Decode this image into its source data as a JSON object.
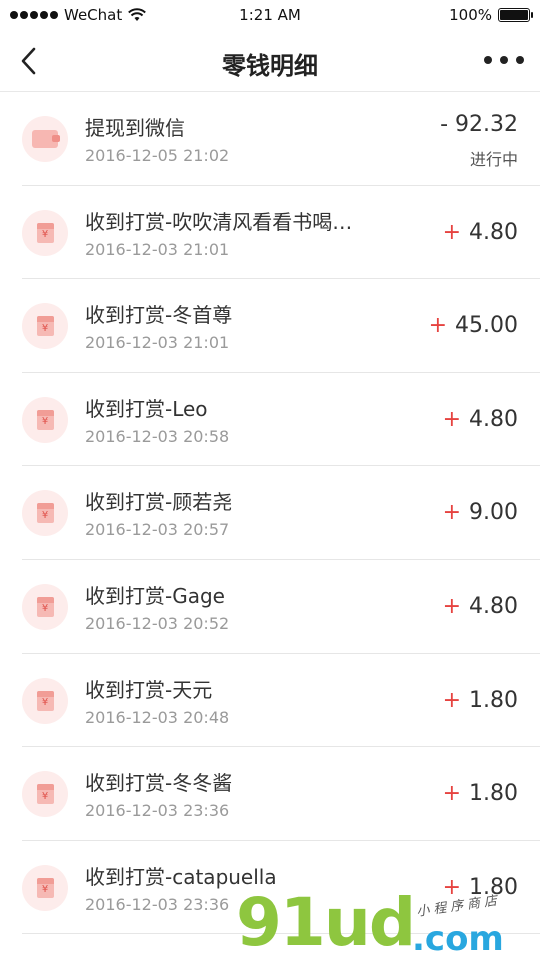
{
  "status_bar": {
    "carrier": "WeChat",
    "time": "1:21 AM",
    "battery": "100%"
  },
  "nav": {
    "title": "零钱明细"
  },
  "transactions": [
    {
      "title": "提现到微信",
      "time": "2016-12-05 21:02",
      "sign": "-",
      "amount": "- 92.32",
      "status": "进行中",
      "icon": "wallet-icon"
    },
    {
      "title": "收到打赏-吹吹清风看看书喝…",
      "time": "2016-12-03 21:01",
      "sign": "+",
      "amount": "4.80",
      "icon": "red-envelope-icon"
    },
    {
      "title": "收到打赏-冬首尊",
      "time": "2016-12-03 21:01",
      "sign": "+",
      "amount": "45.00",
      "icon": "red-envelope-icon"
    },
    {
      "title": "收到打赏-Leo",
      "time": "2016-12-03 20:58",
      "sign": "+",
      "amount": "4.80",
      "icon": "red-envelope-icon"
    },
    {
      "title": "收到打赏-顾若尧",
      "time": "2016-12-03 20:57",
      "sign": "+",
      "amount": "9.00",
      "icon": "red-envelope-icon"
    },
    {
      "title": "收到打赏-Gage",
      "time": "2016-12-03 20:52",
      "sign": "+",
      "amount": "4.80",
      "icon": "red-envelope-icon"
    },
    {
      "title": "收到打赏-天元",
      "time": "2016-12-03 20:48",
      "sign": "+",
      "amount": "1.80",
      "icon": "red-envelope-icon"
    },
    {
      "title": "收到打赏-冬冬酱",
      "time": "2016-12-03 23:36",
      "sign": "+",
      "amount": "1.80",
      "icon": "red-envelope-icon"
    },
    {
      "title": "收到打赏-catapuella",
      "time": "2016-12-03 23:36",
      "sign": "+",
      "amount": "1.80",
      "icon": "red-envelope-icon"
    }
  ],
  "watermark": {
    "main": "91ud",
    "domain": ".com",
    "tagline": "小程序商店"
  },
  "colors": {
    "accent_red": "#e64340",
    "icon_bg": "#fdeceb",
    "watermark_green": "#8ec63f",
    "watermark_blue": "#29a7df"
  }
}
